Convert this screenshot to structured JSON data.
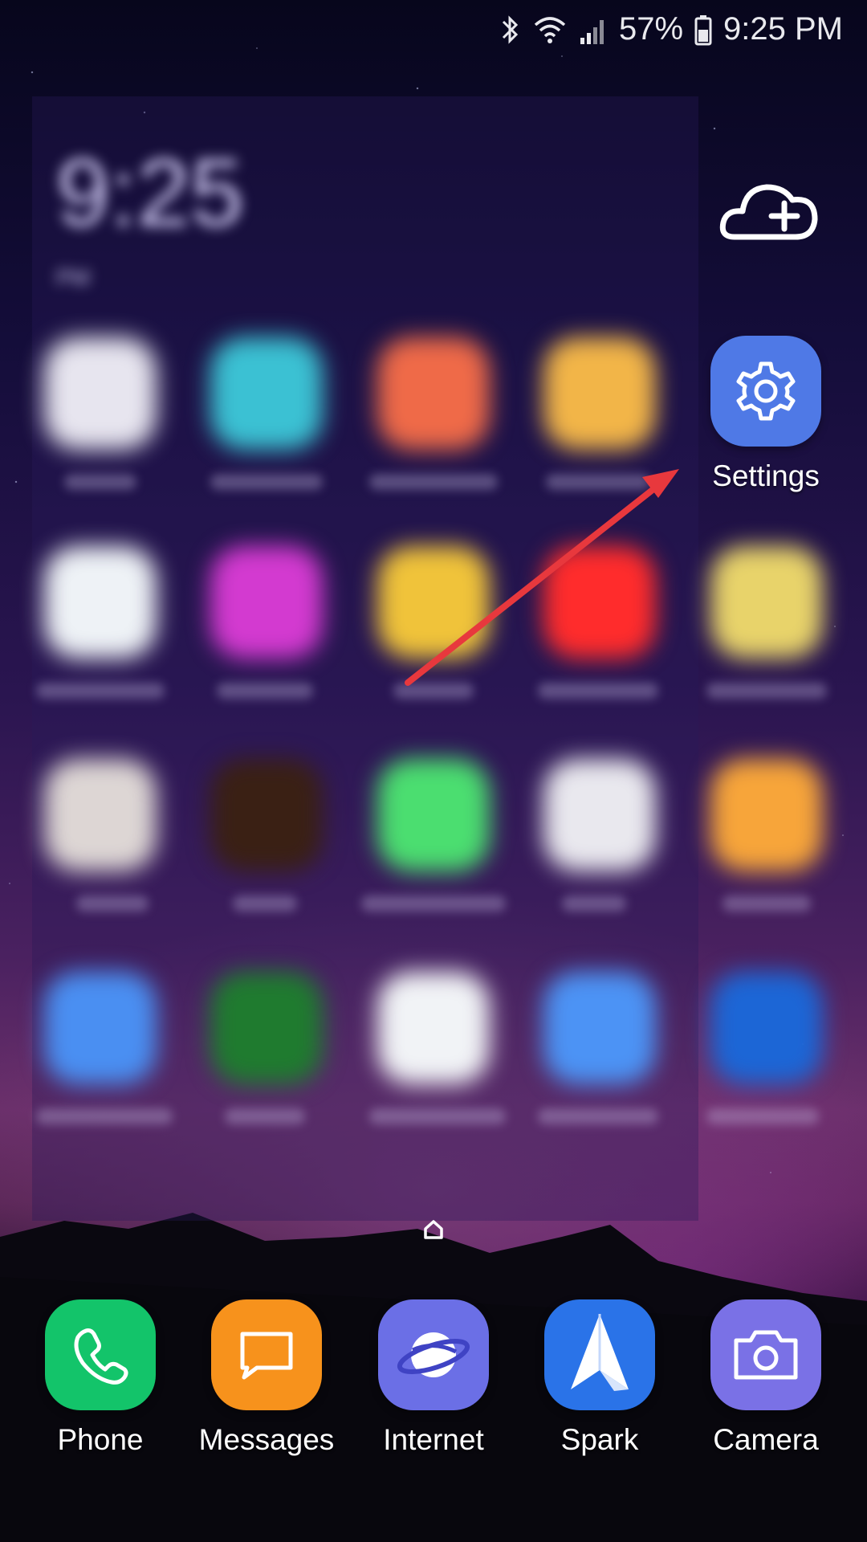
{
  "status": {
    "battery": "57%",
    "time": "9:25 PM",
    "icons": [
      "bluetooth-icon",
      "wifi-icon",
      "cell-signal-icon",
      "battery-icon"
    ]
  },
  "blurred_clock": {
    "time": "9:25",
    "suffix": "PM"
  },
  "settings": {
    "label": "Settings",
    "icon": "gear-icon",
    "color": "#4f79e6"
  },
  "cloud_icon": "cloud-plus-icon",
  "dock": [
    {
      "label": "Phone",
      "icon": "phone-icon",
      "color": "#13c46a"
    },
    {
      "label": "Messages",
      "icon": "message-icon",
      "color": "#f7921c"
    },
    {
      "label": "Internet",
      "icon": "planet-icon",
      "color": "#6b6fe6"
    },
    {
      "label": "Spark",
      "icon": "paper-plane-icon",
      "color": "#2a73e8"
    },
    {
      "label": "Camera",
      "icon": "camera-icon",
      "color": "#7a71e6"
    }
  ],
  "accent_arrow_color": "#e8383d"
}
